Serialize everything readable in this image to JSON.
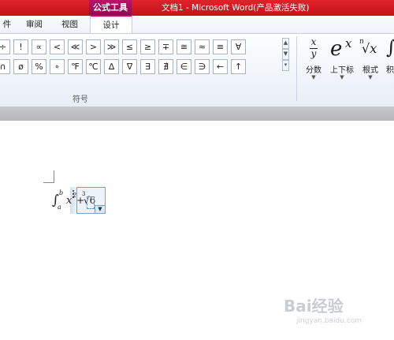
{
  "window": {
    "title": "文档1 - Microsoft Word(产品激活失败)",
    "context_group": "公式工具"
  },
  "tabs": [
    {
      "label": "件"
    },
    {
      "label": "审阅"
    },
    {
      "label": "视图"
    },
    {
      "label": "设计"
    }
  ],
  "symbols": {
    "row1": [
      "÷",
      "!",
      "∝",
      "<",
      "≪",
      ">",
      "≫",
      "≤",
      "≥",
      "∓",
      "≅",
      "≈",
      "≡",
      "∀"
    ],
    "row2": [
      "∩",
      "ø",
      "%",
      "∘",
      "℉",
      "℃",
      "∆",
      "∇",
      "∃",
      "∄",
      "∈",
      "∋",
      "←",
      "↑"
    ],
    "group_label": "符号"
  },
  "structures": {
    "fraction": {
      "label": "分数",
      "glyph_num": "x",
      "glyph_den": "y"
    },
    "script": {
      "label": "上下标",
      "glyph": "e",
      "sup": "x"
    },
    "radical": {
      "label": "根式",
      "glyph": "√x",
      "index": "n"
    },
    "integral": {
      "label": "积",
      "glyph": "∫"
    }
  },
  "document": {
    "equation": {
      "integral": "∫",
      "upper": "b",
      "lower": "a",
      "term": "x",
      "power": "2",
      "plus": "+",
      "root_index": "3",
      "root": "√6"
    }
  },
  "watermark": {
    "text": "Bai经验",
    "sub": "jingyan.baidu.com"
  }
}
